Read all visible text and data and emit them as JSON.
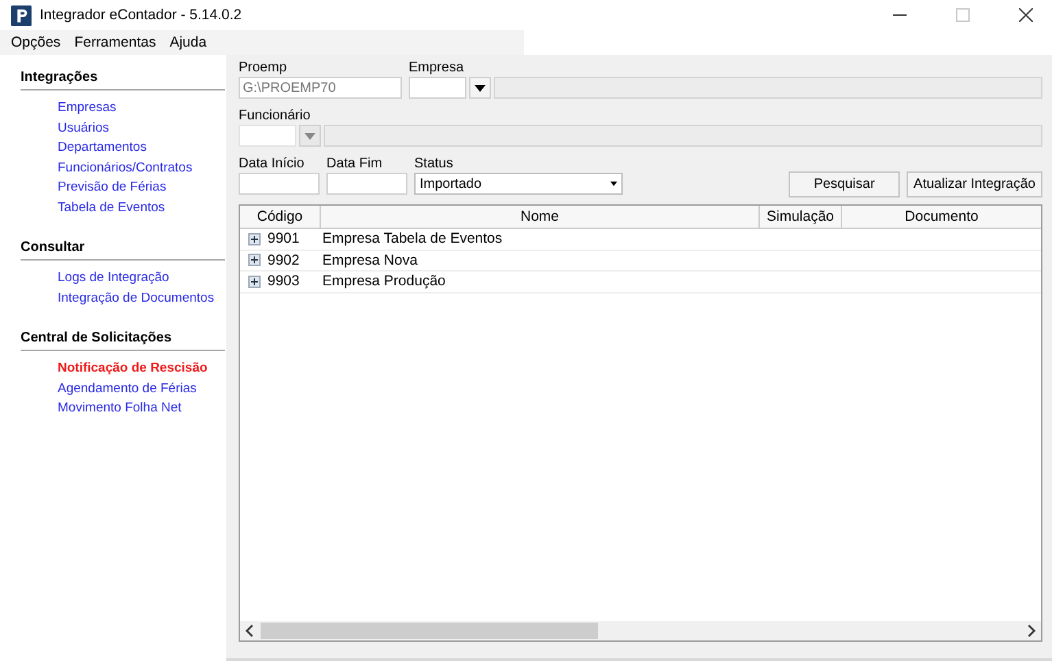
{
  "window": {
    "title": "Integrador eContador - 5.14.0.2",
    "maximize_disabled": true
  },
  "menu": [
    "Opções",
    "Ferramentas",
    "Ajuda"
  ],
  "sidebar": {
    "sections": [
      {
        "title": "Integrações",
        "items": [
          {
            "label": "Empresas",
            "selected": false
          },
          {
            "label": "Usuários",
            "selected": false
          },
          {
            "label": "Departamentos",
            "selected": false
          },
          {
            "label": "Funcionários/Contratos",
            "selected": false
          },
          {
            "label": "Previsão de Férias",
            "selected": false
          },
          {
            "label": "Tabela de Eventos",
            "selected": false
          }
        ]
      },
      {
        "title": "Consultar",
        "items": [
          {
            "label": "Logs de Integração",
            "selected": false
          },
          {
            "label": "Integração de Documentos",
            "selected": false
          }
        ]
      },
      {
        "title": "Central de Solicitações",
        "items": [
          {
            "label": "Notificação de Rescisão",
            "selected": true
          },
          {
            "label": "Agendamento de Férias",
            "selected": false
          },
          {
            "label": "Movimento Folha Net",
            "selected": false
          }
        ]
      }
    ]
  },
  "filters": {
    "proemp": {
      "label": "Proemp",
      "value": "G:\\PROEMP70"
    },
    "empresa": {
      "label": "Empresa"
    },
    "funcionario": {
      "label": "Funcionário",
      "disabled": true
    },
    "data_inicio": {
      "label": "Data Início"
    },
    "data_fim": {
      "label": "Data Fim"
    },
    "status": {
      "label": "Status",
      "value": "Importado"
    }
  },
  "buttons": [
    "Pesquisar",
    "Atualizar Integração"
  ],
  "table": {
    "columns": [
      "Código",
      "Nome",
      "Simulação",
      "Documento"
    ],
    "rows": [
      {
        "codigo": "9901",
        "nome": "Empresa Tabela de Eventos",
        "expanded": false
      },
      {
        "codigo": "9902",
        "nome": "Empresa Nova",
        "expanded": false
      },
      {
        "codigo": "9903",
        "nome": "Empresa Produção",
        "expanded": false
      }
    ]
  }
}
